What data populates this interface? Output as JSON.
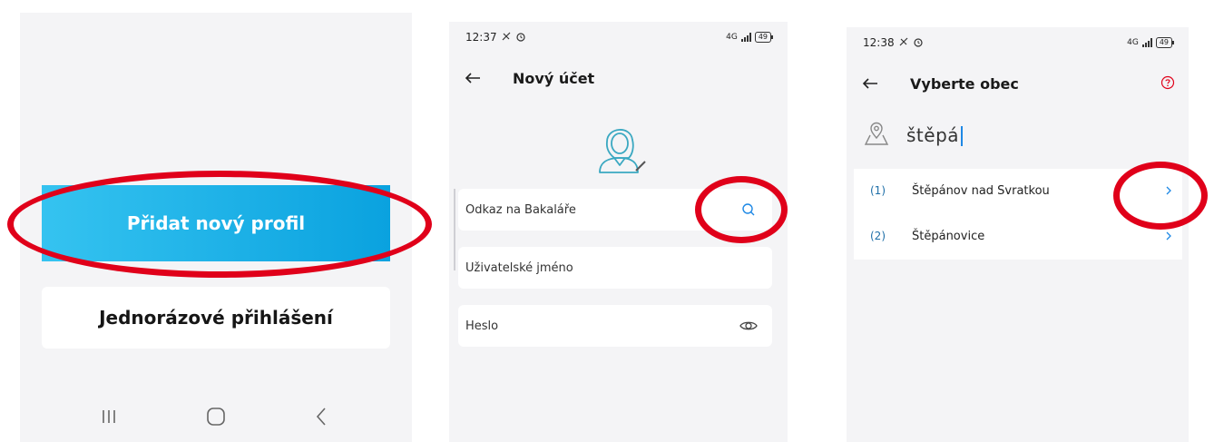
{
  "screen1": {
    "primary_button": "Přidat nový profil",
    "secondary_button": "Jednorázové přihlášení",
    "nav": {
      "recents_icon": "recents-icon",
      "home_icon": "home-icon",
      "back_icon": "back-icon"
    }
  },
  "screen2": {
    "status": {
      "time": "12:37",
      "network": "4G",
      "battery": "49"
    },
    "header": {
      "title": "Nový účet"
    },
    "fields": {
      "link_label": "Odkaz na Bakaláře",
      "username_label": "Uživatelské jméno",
      "password_label": "Heslo"
    }
  },
  "screen3": {
    "status": {
      "time": "12:38",
      "network": "4G",
      "battery": "49"
    },
    "header": {
      "title": "Vyberte obec"
    },
    "search": {
      "value": "štěpá"
    },
    "results": [
      {
        "index": "(1)",
        "name": "Štěpánov nad Svratkou"
      },
      {
        "index": "(2)",
        "name": "Štěpánovice"
      }
    ]
  },
  "colors": {
    "accent": "#0aa2df",
    "accent_light": "#35c3f0",
    "annotation_red": "#e0001a",
    "background": "#f4f4f6"
  }
}
